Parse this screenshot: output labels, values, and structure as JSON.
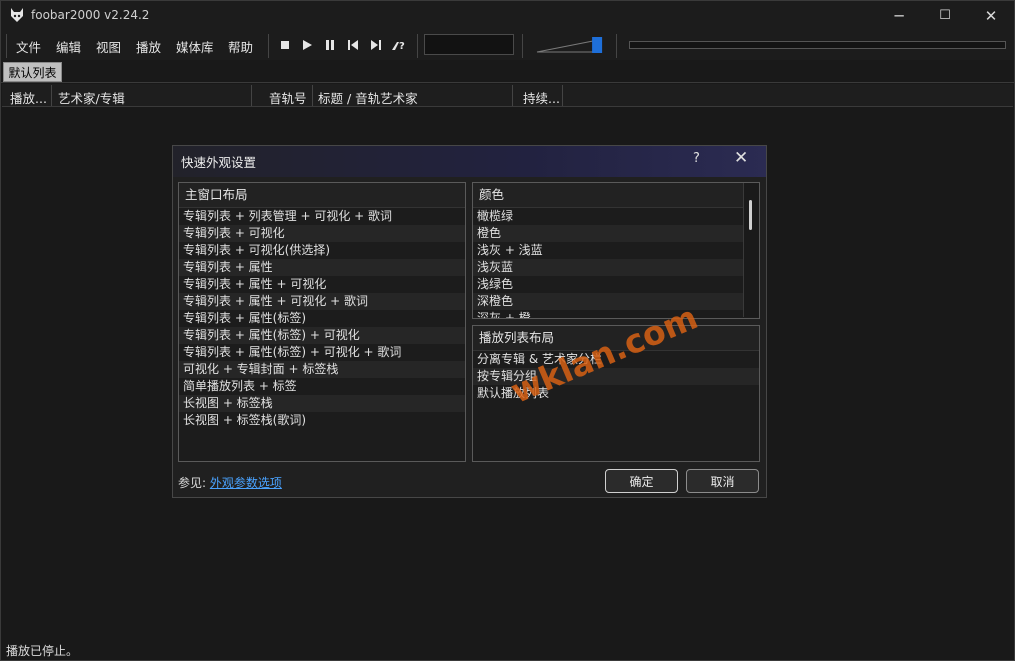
{
  "window": {
    "title": "foobar2000 v2.24.2",
    "controls": [
      "─",
      "☐",
      "✕"
    ]
  },
  "menu": [
    "文件",
    "编辑",
    "视图",
    "播放",
    "媒体库",
    "帮助"
  ],
  "toolbar": {
    "buttons": [
      "stop-icon",
      "play-icon",
      "pause-icon",
      "previous-icon",
      "next-icon",
      "random-icon"
    ],
    "volume_level": 0.95
  },
  "tabs": {
    "active": "默认列表"
  },
  "columns": [
    "播放...",
    "艺术家/专辑",
    "音轨号",
    "标题 / 音轨艺术家",
    "持续..."
  ],
  "status": "播放已停止。",
  "dialog": {
    "title": "快速外观设置",
    "help": "?",
    "close": "✕",
    "layout_panel": {
      "header": "主窗口布局",
      "items": [
        "专辑列表 + 列表管理 + 可视化 + 歌词",
        "专辑列表 + 可视化",
        "专辑列表 + 可视化(供选择)",
        "专辑列表 + 属性",
        "专辑列表 + 属性 + 可视化",
        "专辑列表 + 属性 + 可视化 + 歌词",
        "专辑列表 + 属性(标签)",
        "专辑列表 + 属性(标签) + 可视化",
        "专辑列表 + 属性(标签) + 可视化 + 歌词",
        "可视化 + 专辑封面 + 标签栈",
        "简单播放列表 + 标签",
        "长视图 + 标签栈",
        "长视图 + 标签栈(歌词)"
      ]
    },
    "color_panel": {
      "header": "颜色",
      "items": [
        "橄榄绿",
        "橙色",
        "浅灰 + 浅蓝",
        "浅灰蓝",
        "浅绿色",
        "深橙色",
        "深灰 + 橙"
      ]
    },
    "playlist_panel": {
      "header": "播放列表布局",
      "items": [
        "分离专辑 & 艺术家分栏",
        "按专辑分组",
        "默认播放列表"
      ]
    },
    "see_also_label": "参见: ",
    "see_also_link": "外观参数选项",
    "ok": "确定",
    "cancel": "取消"
  },
  "watermark": "wklan.com",
  "colors": {
    "accent": "#1e6fd9",
    "link": "#4aa3ff",
    "watermark": "#d66014"
  }
}
